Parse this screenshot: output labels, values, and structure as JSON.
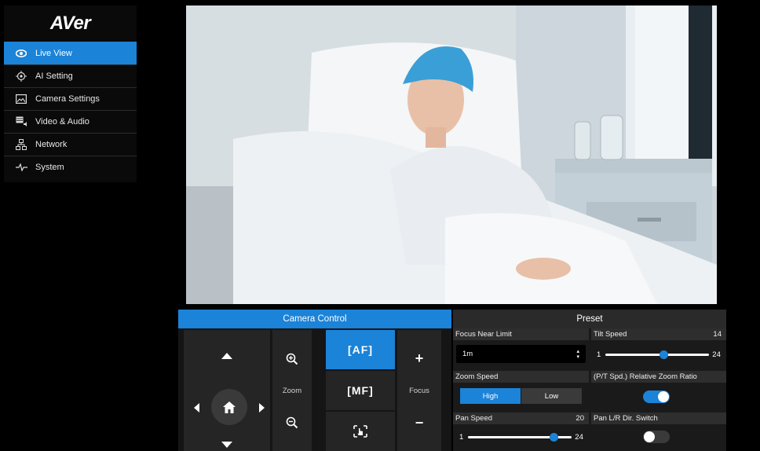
{
  "brand": {
    "logo_text": "AVer"
  },
  "sidebar": {
    "items": [
      {
        "label": "Live View",
        "icon": "eye-icon",
        "active": true
      },
      {
        "label": "AI Setting",
        "icon": "ai-target-icon",
        "active": false
      },
      {
        "label": "Camera Settings",
        "icon": "image-icon",
        "active": false
      },
      {
        "label": "Video & Audio",
        "icon": "video-audio-icon",
        "active": false
      },
      {
        "label": "Network",
        "icon": "network-icon",
        "active": false
      },
      {
        "label": "System",
        "icon": "pulse-icon",
        "active": false
      }
    ]
  },
  "camera_control": {
    "title": "Camera Control",
    "zoom_label": "Zoom",
    "focus_label": "Focus",
    "af_label": "AF",
    "mf_label": "MF",
    "focus_plus": "+",
    "focus_minus": "−"
  },
  "preset": {
    "title": "Preset",
    "focus_near_limit": {
      "label": "Focus Near Limit",
      "value": "1m"
    },
    "zoom_speed": {
      "label": "Zoom Speed",
      "options": [
        "High",
        "Low"
      ],
      "selected": "High"
    },
    "pan_speed": {
      "label": "Pan Speed",
      "value": "20",
      "min": "1",
      "max": "24"
    },
    "tilt_speed": {
      "label": "Tilt Speed",
      "value": "14",
      "min": "1",
      "max": "24"
    },
    "relative_zoom": {
      "label": "(P/T Spd.) Relative Zoom Ratio",
      "on": true
    },
    "pan_switch": {
      "label": "Pan L/R Dir. Switch",
      "on": false
    }
  },
  "colors": {
    "accent": "#1b83d8",
    "panel": "#252525"
  }
}
